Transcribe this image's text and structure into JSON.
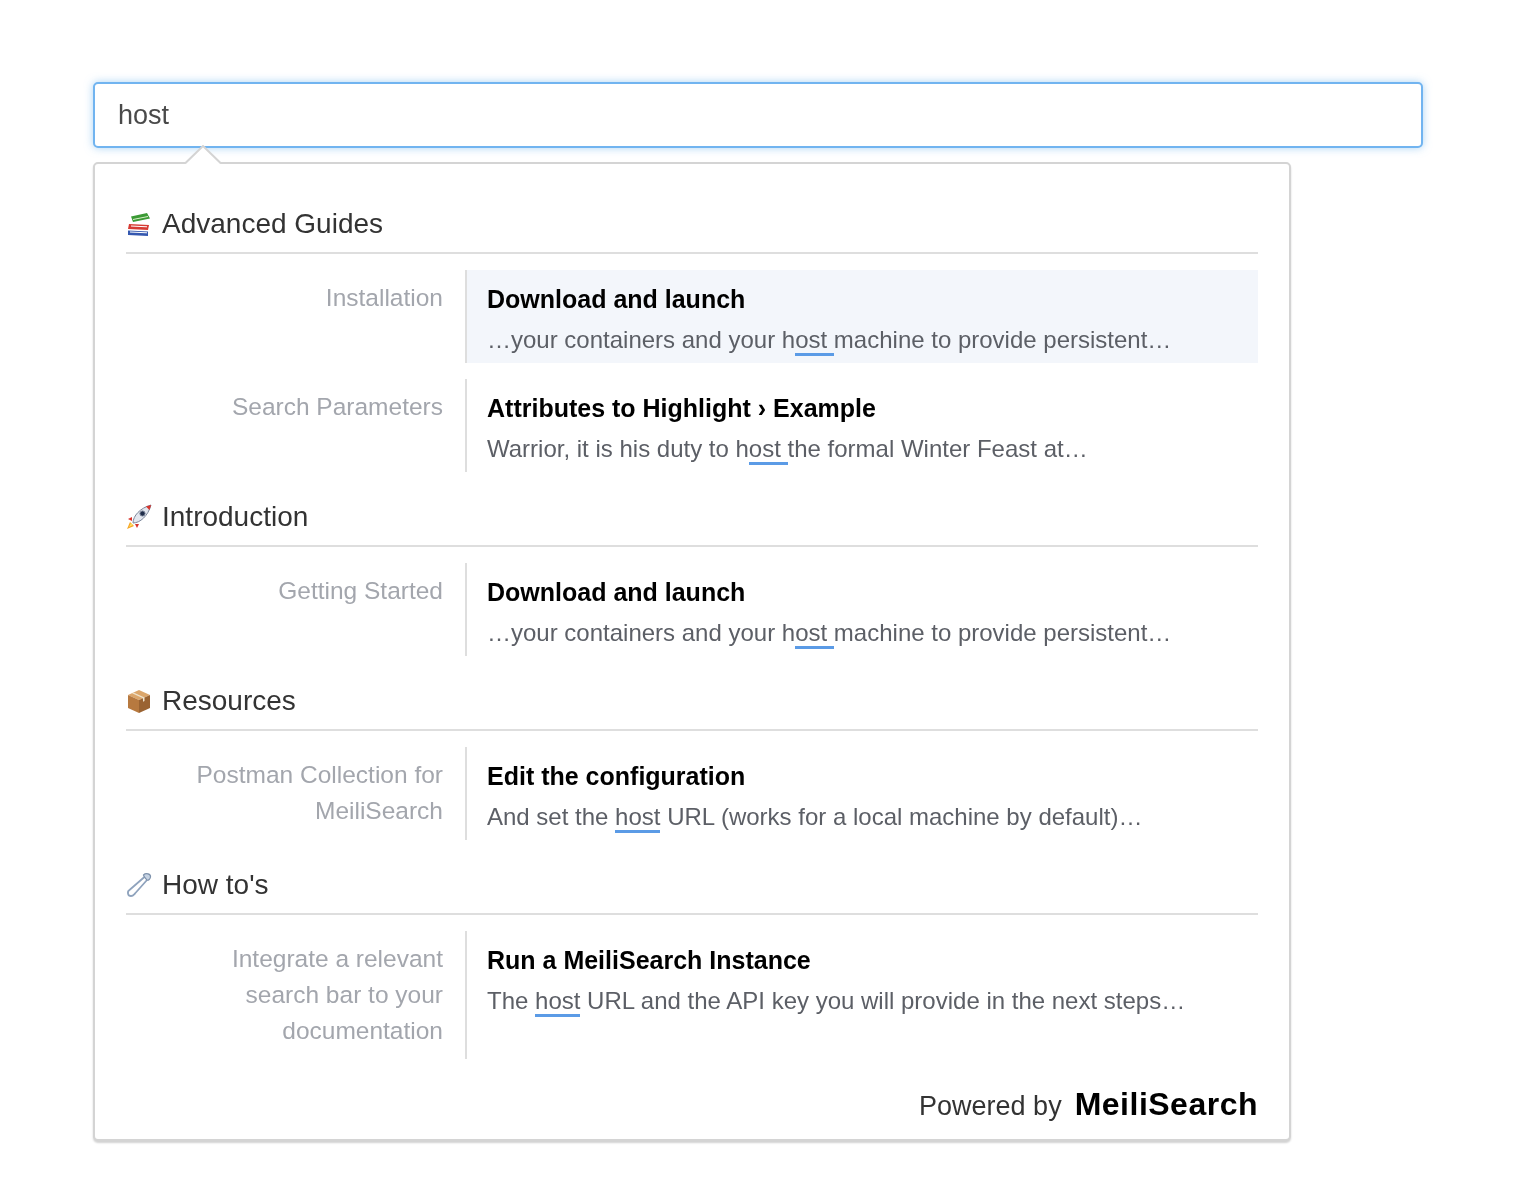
{
  "search": {
    "value": "host"
  },
  "results": {
    "sections": [
      {
        "kind": "books",
        "title": "Advanced Guides",
        "hits": [
          {
            "category": "Installation",
            "title": "Download and launch",
            "snippet": [
              {
                "text": "…your containers and your h",
                "highlighted": false
              },
              {
                "text": "ost ",
                "highlighted": true
              },
              {
                "text": "machine to provide persistent…",
                "highlighted": false
              }
            ],
            "selected": true
          },
          {
            "category": "Search Parameters",
            "title": "Attributes to Highlight › Example",
            "snippet": [
              {
                "text": "Warrior, it is his duty to h",
                "highlighted": false
              },
              {
                "text": "ost ",
                "highlighted": true
              },
              {
                "text": "the formal Winter Feast at…",
                "highlighted": false
              }
            ],
            "selected": false
          }
        ]
      },
      {
        "kind": "rocket",
        "title": "Introduction",
        "hits": [
          {
            "category": "Getting Started",
            "title": "Download and launch",
            "snippet": [
              {
                "text": "…your containers and your h",
                "highlighted": false
              },
              {
                "text": "ost ",
                "highlighted": true
              },
              {
                "text": "machine to provide persistent…",
                "highlighted": false
              }
            ],
            "selected": false
          }
        ]
      },
      {
        "kind": "package",
        "title": "Resources",
        "hits": [
          {
            "category": "Postman Collection for MeiliSearch",
            "title": "Edit the configuration",
            "snippet": [
              {
                "text": "And set the ",
                "highlighted": false
              },
              {
                "text": "host",
                "highlighted": true
              },
              {
                "text": " URL (works for a local machine by default)…",
                "highlighted": false
              }
            ],
            "selected": false
          }
        ]
      },
      {
        "kind": "pin",
        "title": "How to's",
        "hits": [
          {
            "category": "Integrate a relevant search bar to your documentation",
            "title": "Run a MeiliSearch Instance",
            "snippet": [
              {
                "text": "The ",
                "highlighted": false
              },
              {
                "text": "host",
                "highlighted": true
              },
              {
                "text": " URL and the API key you will provide in the next steps…",
                "highlighted": false
              }
            ],
            "selected": false
          }
        ]
      }
    ]
  },
  "footer": {
    "label": "Powered by",
    "brand": "MeiliSearch"
  }
}
